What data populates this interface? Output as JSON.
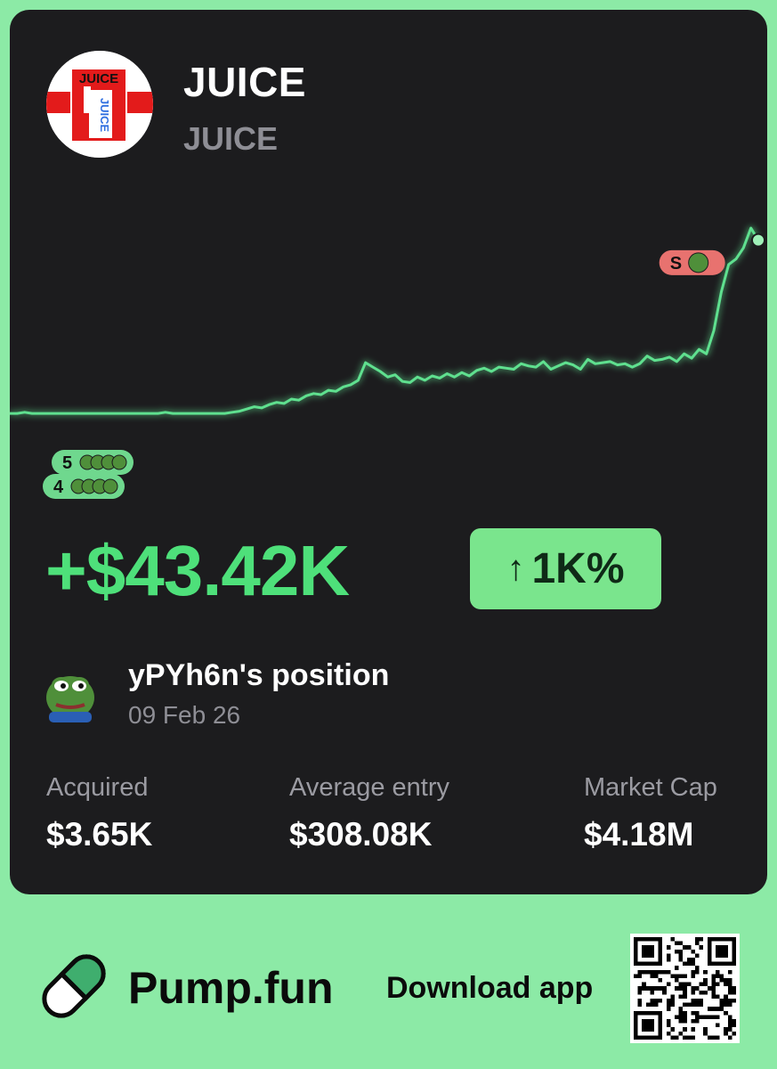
{
  "token": {
    "name": "JUICE",
    "symbol": "JUICE",
    "logo_text": "JUICE",
    "logo_carton_text": "JUICE"
  },
  "chart_data": {
    "type": "line",
    "title": "",
    "xlabel": "",
    "ylabel": "",
    "line_color": "#5fe08f",
    "y": [
      50,
      50,
      51,
      50,
      50,
      50,
      50,
      50,
      50,
      50,
      50,
      50,
      50,
      50,
      50,
      50,
      50,
      50,
      50,
      50,
      50,
      51,
      50,
      50,
      50,
      50,
      50,
      50,
      50,
      50,
      51,
      52,
      54,
      56,
      55,
      58,
      60,
      59,
      63,
      62,
      66,
      68,
      67,
      71,
      70,
      74,
      76,
      80,
      96,
      92,
      88,
      83,
      85,
      79,
      78,
      83,
      80,
      84,
      82,
      86,
      83,
      87,
      84,
      89,
      91,
      88,
      92,
      91,
      90,
      95,
      93,
      92,
      97,
      90,
      93,
      96,
      94,
      90,
      99,
      95,
      96,
      97,
      94,
      95,
      92,
      95,
      102,
      98,
      99,
      101,
      97,
      104,
      100,
      108,
      104,
      125,
      160,
      185,
      190,
      200,
      218,
      207
    ],
    "markers": [
      {
        "label": "5",
        "index": 8,
        "kind": "buy"
      },
      {
        "label": "4",
        "index": 6,
        "kind": "buy"
      },
      {
        "label": "S",
        "index": 97,
        "kind": "sell"
      }
    ]
  },
  "position": {
    "pnl": "+$43.42K",
    "pnl_percent": "1K%",
    "pnl_arrow": "↑",
    "owner": "yPYh6n's position",
    "date": "09 Feb 26"
  },
  "stats": [
    {
      "label": "Acquired",
      "value": "$3.65K"
    },
    {
      "label": "Average entry",
      "value": "$308.08K"
    },
    {
      "label": "Market Cap",
      "value": "$4.18M"
    }
  ],
  "footer": {
    "brand": "Pump.fun",
    "download": "Download app"
  },
  "colors": {
    "background": "#8ceaa6",
    "card": "#1c1c1e",
    "positive": "#4ee07a",
    "badge": "#7ae58d",
    "sell_marker": "#e8726f"
  }
}
